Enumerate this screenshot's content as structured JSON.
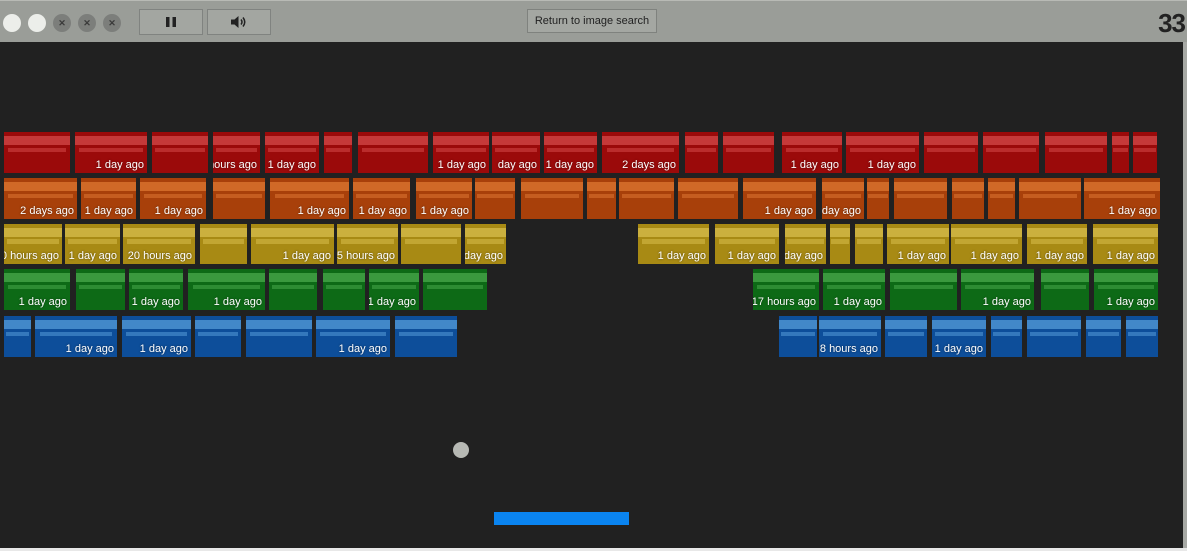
{
  "topbar": {
    "window_controls": [
      {
        "icon": "circle-icon",
        "style": "white"
      },
      {
        "icon": "circle-icon",
        "style": "white"
      },
      {
        "icon": "close-icon",
        "style": "x"
      },
      {
        "icon": "close-icon",
        "style": "x"
      },
      {
        "icon": "close-icon",
        "style": "x"
      }
    ],
    "pause_icon": "pause-icon",
    "sound_icon": "speaker-icon",
    "return_label": "Return to image search",
    "score": "33"
  },
  "colors": {
    "row_colors": [
      "#9b0a0a",
      "#a8400a",
      "#a88a14",
      "#0d6a16",
      "#0d4e9a"
    ],
    "row_highlights": [
      "#e86060",
      "#f08a40",
      "#e8d060",
      "#60c060",
      "#70b8f0"
    ],
    "paddle": "#0a84f0",
    "ball": "#b7b9b4",
    "background": "#212121"
  },
  "rows": [
    {
      "bricks": [
        {
          "label": ""
        },
        {
          "label": "1 day ago"
        },
        {
          "label": ""
        },
        {
          "label": "hours ago"
        },
        {
          "label": "1 day ago"
        },
        {
          "label": ""
        },
        {
          "label": ""
        },
        {
          "label": "1 day ago"
        },
        {
          "label": "day ago"
        },
        {
          "label": "1 day ago"
        },
        {
          "label": "2 days ago"
        },
        {
          "label": ""
        },
        {
          "label": ""
        },
        {
          "label": "1 day ago"
        },
        {
          "label": "1 day ago"
        },
        {
          "label": ""
        },
        {
          "label": ""
        },
        {
          "label": ""
        },
        {
          "label": ""
        },
        {
          "label": ""
        }
      ]
    },
    {
      "bricks": [
        {
          "label": "2 days ago"
        },
        {
          "label": "1 day ago"
        },
        {
          "label": "1 day ago"
        },
        {
          "label": ""
        },
        {
          "label": "1 day ago"
        },
        {
          "label": "1 day ago"
        },
        {
          "label": "1 day ago"
        },
        {
          "label": ""
        },
        {
          "label": ""
        },
        {
          "label": ""
        },
        {
          "label": ""
        },
        {
          "label": ""
        },
        {
          "label": "1 day ago"
        },
        {
          "label": "day ago"
        },
        {
          "label": ""
        },
        {
          "label": ""
        },
        {
          "label": ""
        },
        {
          "label": ""
        },
        {
          "label": ""
        },
        {
          "label": "1 day ago"
        }
      ]
    },
    {
      "bricks": [
        {
          "label": "0 hours ago"
        },
        {
          "label": "1 day ago"
        },
        {
          "label": "20 hours ago"
        },
        {
          "label": ""
        },
        {
          "label": "1 day ago"
        },
        {
          "label": "5 hours ago"
        },
        {
          "label": ""
        },
        {
          "label": "day ago"
        },
        {
          "label": "1 day ago"
        },
        {
          "label": "1 day ago"
        },
        {
          "label": "day ago"
        },
        {
          "label": ""
        },
        {
          "label": ""
        },
        {
          "label": "1 day ago"
        },
        {
          "label": "1 day ago"
        },
        {
          "label": "1 day ago"
        },
        {
          "label": "1 day ago"
        }
      ]
    },
    {
      "bricks": [
        {
          "label": "1 day ago"
        },
        {
          "label": ""
        },
        {
          "label": "1 day ago"
        },
        {
          "label": "1 day ago"
        },
        {
          "label": ""
        },
        {
          "label": ""
        },
        {
          "label": "1 day ago"
        },
        {
          "label": ""
        },
        {
          "label": "17 hours ago"
        },
        {
          "label": "1 day ago"
        },
        {
          "label": ""
        },
        {
          "label": "1 day ago"
        },
        {
          "label": ""
        },
        {
          "label": "1 day ago"
        }
      ]
    },
    {
      "bricks": [
        {
          "label": ""
        },
        {
          "label": "1 day ago"
        },
        {
          "label": "1 day ago"
        },
        {
          "label": ""
        },
        {
          "label": ""
        },
        {
          "label": "1 day ago"
        },
        {
          "label": ""
        },
        {
          "label": ""
        },
        {
          "label": "8 hours ago"
        },
        {
          "label": ""
        },
        {
          "label": "1 day ago"
        },
        {
          "label": ""
        },
        {
          "label": ""
        },
        {
          "label": ""
        },
        {
          "label": ""
        }
      ]
    }
  ]
}
